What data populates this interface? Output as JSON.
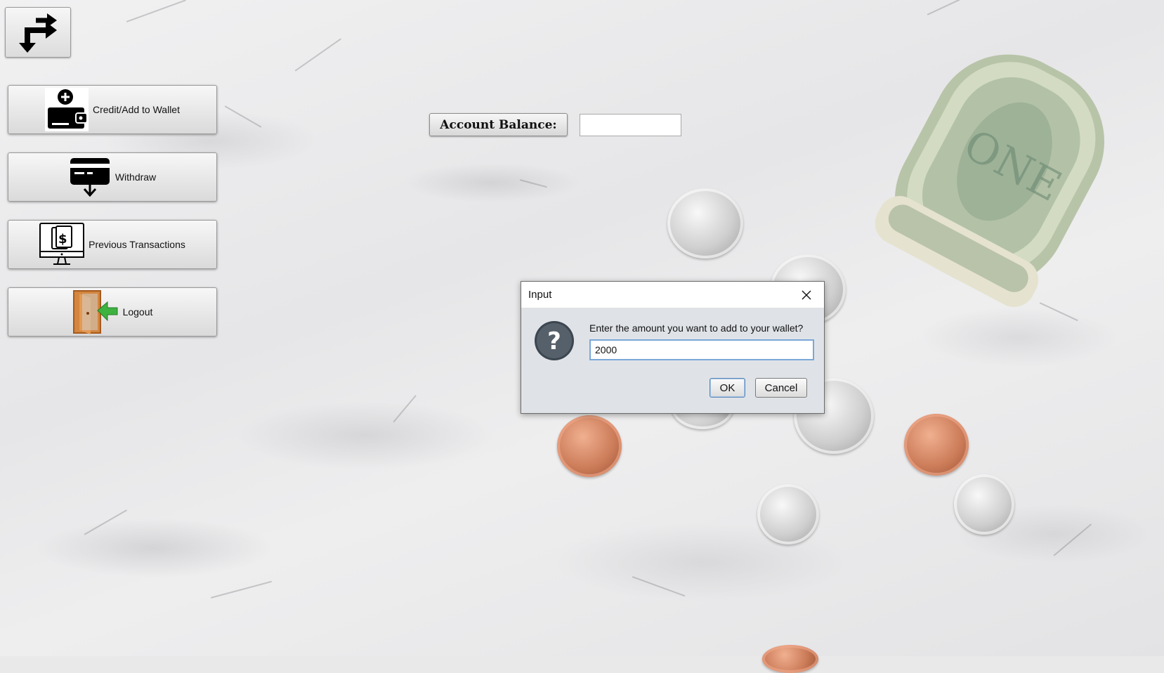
{
  "sidebar": {
    "top_icon": "redirect-arrows-icon",
    "buttons": [
      {
        "label": "Credit/Add to Wallet",
        "icon": "wallet-add-icon"
      },
      {
        "label": "Withdraw",
        "icon": "card-withdraw-icon"
      },
      {
        "label": "Previous Transactions",
        "icon": "transactions-monitor-icon"
      },
      {
        "label": "Logout",
        "icon": "door-exit-icon"
      }
    ]
  },
  "main": {
    "balance_label": "Account Balance:",
    "balance_value": ""
  },
  "dialog": {
    "title": "Input",
    "prompt": "Enter the amount you want to add to your wallet?",
    "input_value": "2000",
    "ok_label": "OK",
    "cancel_label": "Cancel",
    "icon": "question-icon"
  },
  "colors": {
    "dialog_bg": "#dfe3e8",
    "input_focus_border": "#7aa7d8",
    "ok_border": "#5d87b6"
  }
}
